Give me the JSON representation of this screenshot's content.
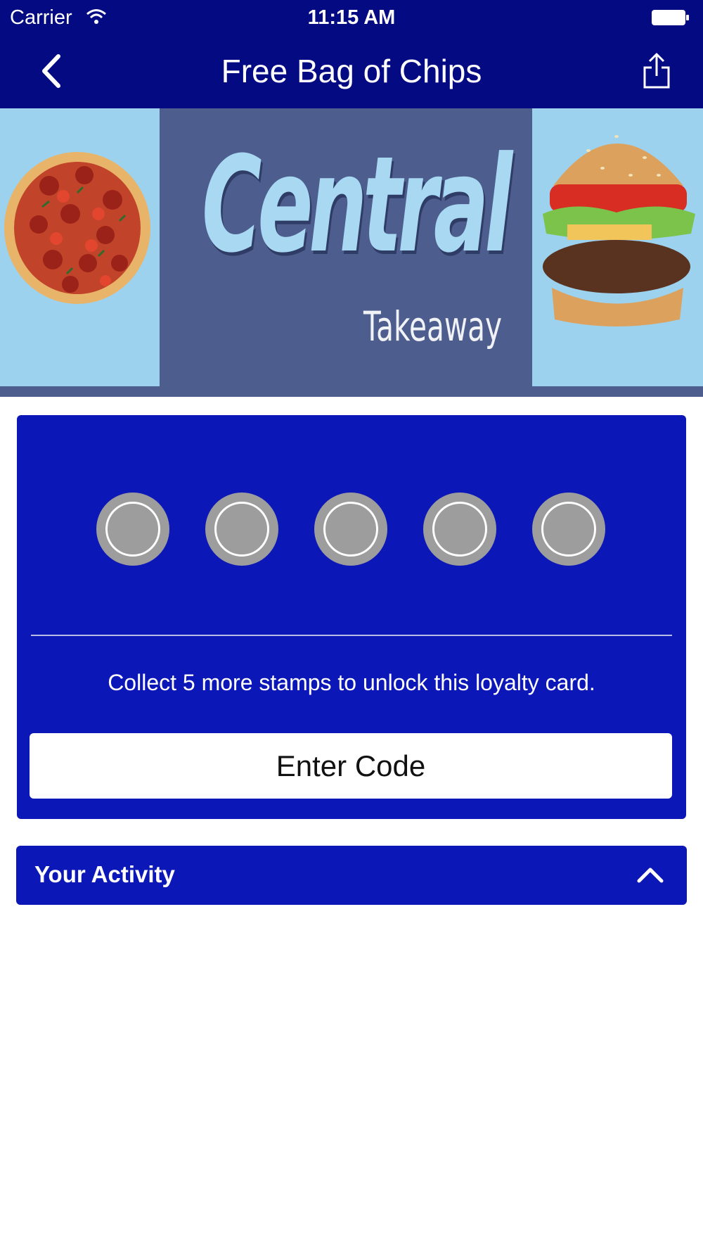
{
  "status_bar": {
    "carrier": "Carrier",
    "time": "11:15 AM"
  },
  "nav": {
    "title": "Free Bag of Chips",
    "back_icon": "chevron-left-icon",
    "share_icon": "share-icon"
  },
  "banner": {
    "brand_name": "Central",
    "brand_tagline": "Takeaway"
  },
  "colors": {
    "nav_bg": "#030a82",
    "card_bg": "#0c17b7",
    "banner_bg": "#4d5d8d",
    "banner_side_bg": "#9dd2ee",
    "stamp": "#9d9d9d"
  },
  "loyalty_card": {
    "stamps": [
      {
        "state": "empty"
      },
      {
        "state": "empty"
      },
      {
        "state": "empty"
      },
      {
        "state": "empty"
      },
      {
        "state": "empty"
      }
    ],
    "message": "Collect 5 more stamps to unlock this loyalty card.",
    "enter_code_label": "Enter Code"
  },
  "activity": {
    "label": "Your Activity",
    "icon": "chevron-up-icon"
  }
}
